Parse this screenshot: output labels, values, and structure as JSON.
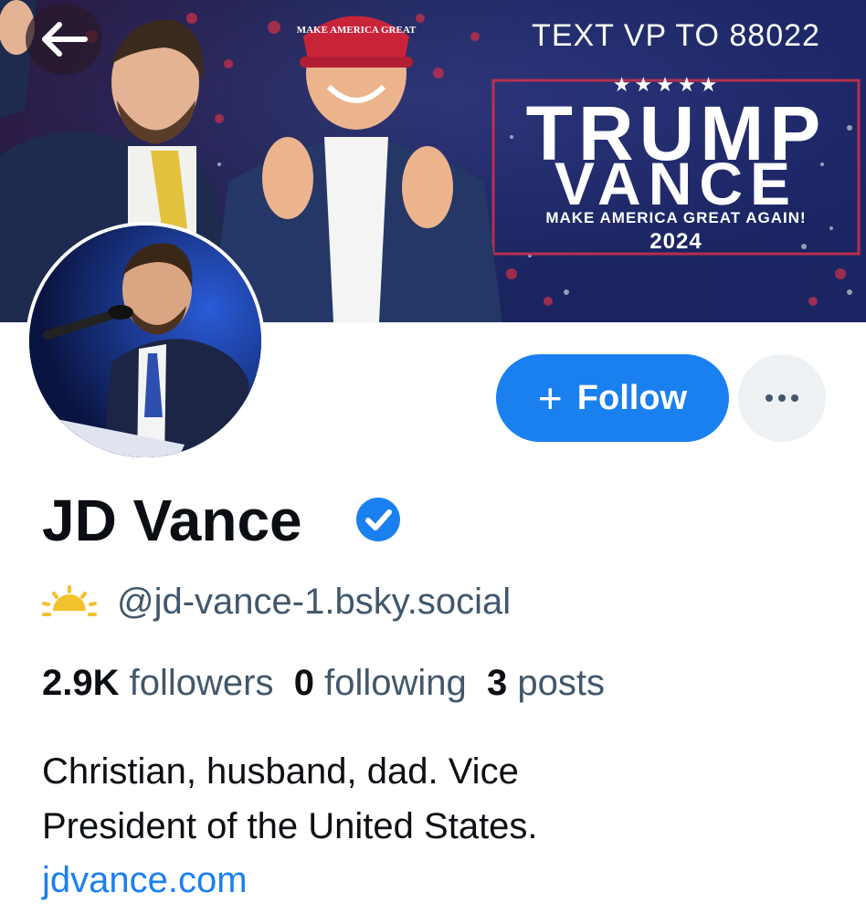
{
  "banner": {
    "text_line": "TEXT VP TO 88022",
    "stars": "★★★★★",
    "title_line1": "TRUMP",
    "title_line2": "VANCE",
    "slogan": "MAKE AMERICA GREAT AGAIN!",
    "year": "2024",
    "hat_text": "MAKE AMERICA GREAT"
  },
  "back_icon": "arrow-left-icon",
  "profile": {
    "display_name": "JD Vance",
    "handle": "@jd-vance-1.bsky.social",
    "handle_icon": "sun-icon",
    "followers_count": "2.9K",
    "followers_label": "followers",
    "following_count": "0",
    "following_label": "following",
    "posts_count": "3",
    "posts_label": "posts",
    "bio_line1": "Christian, husband, dad. Vice",
    "bio_line2": "President of the United States.",
    "website": "jdvance.com"
  },
  "actions": {
    "follow_label": "Follow",
    "more_icon": "ellipsis-icon"
  },
  "colors": {
    "accent": "#1a80f0",
    "text_primary": "#0b0f14",
    "text_secondary": "#42576b",
    "more_bg": "#eef1f4"
  }
}
